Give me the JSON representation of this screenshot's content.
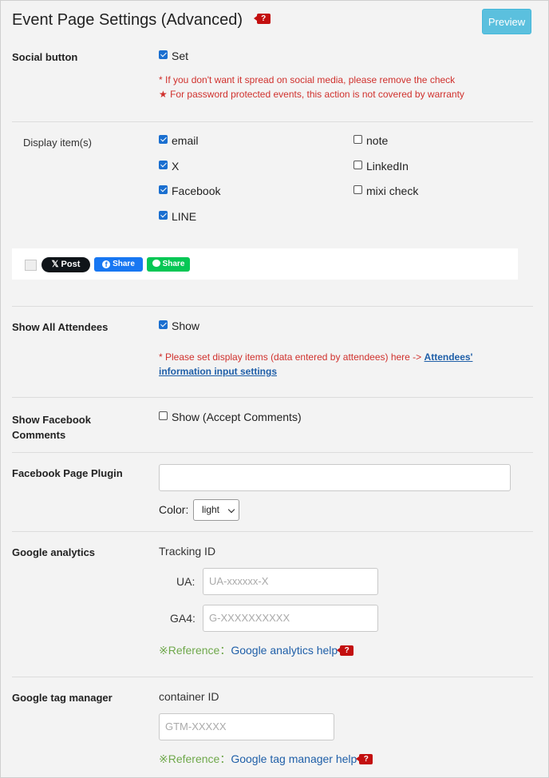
{
  "header": {
    "title": "Event Page Settings (Advanced)",
    "help_label": "?",
    "preview_label": "Preview"
  },
  "social_button": {
    "label": "Social button",
    "set_label": "Set",
    "note1": "* If you don't want it spread on social media, please remove the check",
    "note2": "★ For password protected events, this action is not covered by warranty"
  },
  "display_items": {
    "label": "Display item(s)",
    "items": [
      {
        "label": "email",
        "checked": true
      },
      {
        "label": "X",
        "checked": true
      },
      {
        "label": "Facebook",
        "checked": true
      },
      {
        "label": "LINE",
        "checked": true
      },
      {
        "label": "note",
        "checked": false
      },
      {
        "label": "LinkedIn",
        "checked": false
      },
      {
        "label": "mixi check",
        "checked": false
      }
    ]
  },
  "share_preview": {
    "x_post": "Post",
    "fb_share": "Share",
    "line_share": "Share"
  },
  "show_attendees": {
    "label": "Show All Attendees",
    "show_label": "Show",
    "note": "* Please set display items (data entered by attendees) here -> ",
    "link_line1": "Attendees'",
    "link_line2": "information input settings"
  },
  "fb_comments": {
    "label_line1": "Show Facebook",
    "label_line2": "Comments",
    "show_label": "Show (Accept Comments)"
  },
  "fb_page_plugin": {
    "label": "Facebook Page Plugin",
    "value": "",
    "color_label": "Color:",
    "color_value": "light"
  },
  "google_analytics": {
    "label": "Google analytics",
    "tracking_label": "Tracking ID",
    "ua_label": "UA:",
    "ua_placeholder": "UA-xxxxxx-X",
    "ga4_label": "GA4:",
    "ga4_placeholder": "G-XXXXXXXXXX",
    "ref_prefix": "※Reference：",
    "ref_link": "Google analytics help"
  },
  "google_tag_manager": {
    "label": "Google tag manager",
    "container_label": "container ID",
    "placeholder": "GTM-XXXXX",
    "ref_prefix": "※Reference：",
    "ref_link": "Google tag manager help"
  },
  "colors": {
    "accent": "#5bc0de",
    "note_red": "#d0312d",
    "link": "#1f5fa8",
    "checkbox": "#1a6fd0",
    "help_badge": "#c30f0f"
  }
}
